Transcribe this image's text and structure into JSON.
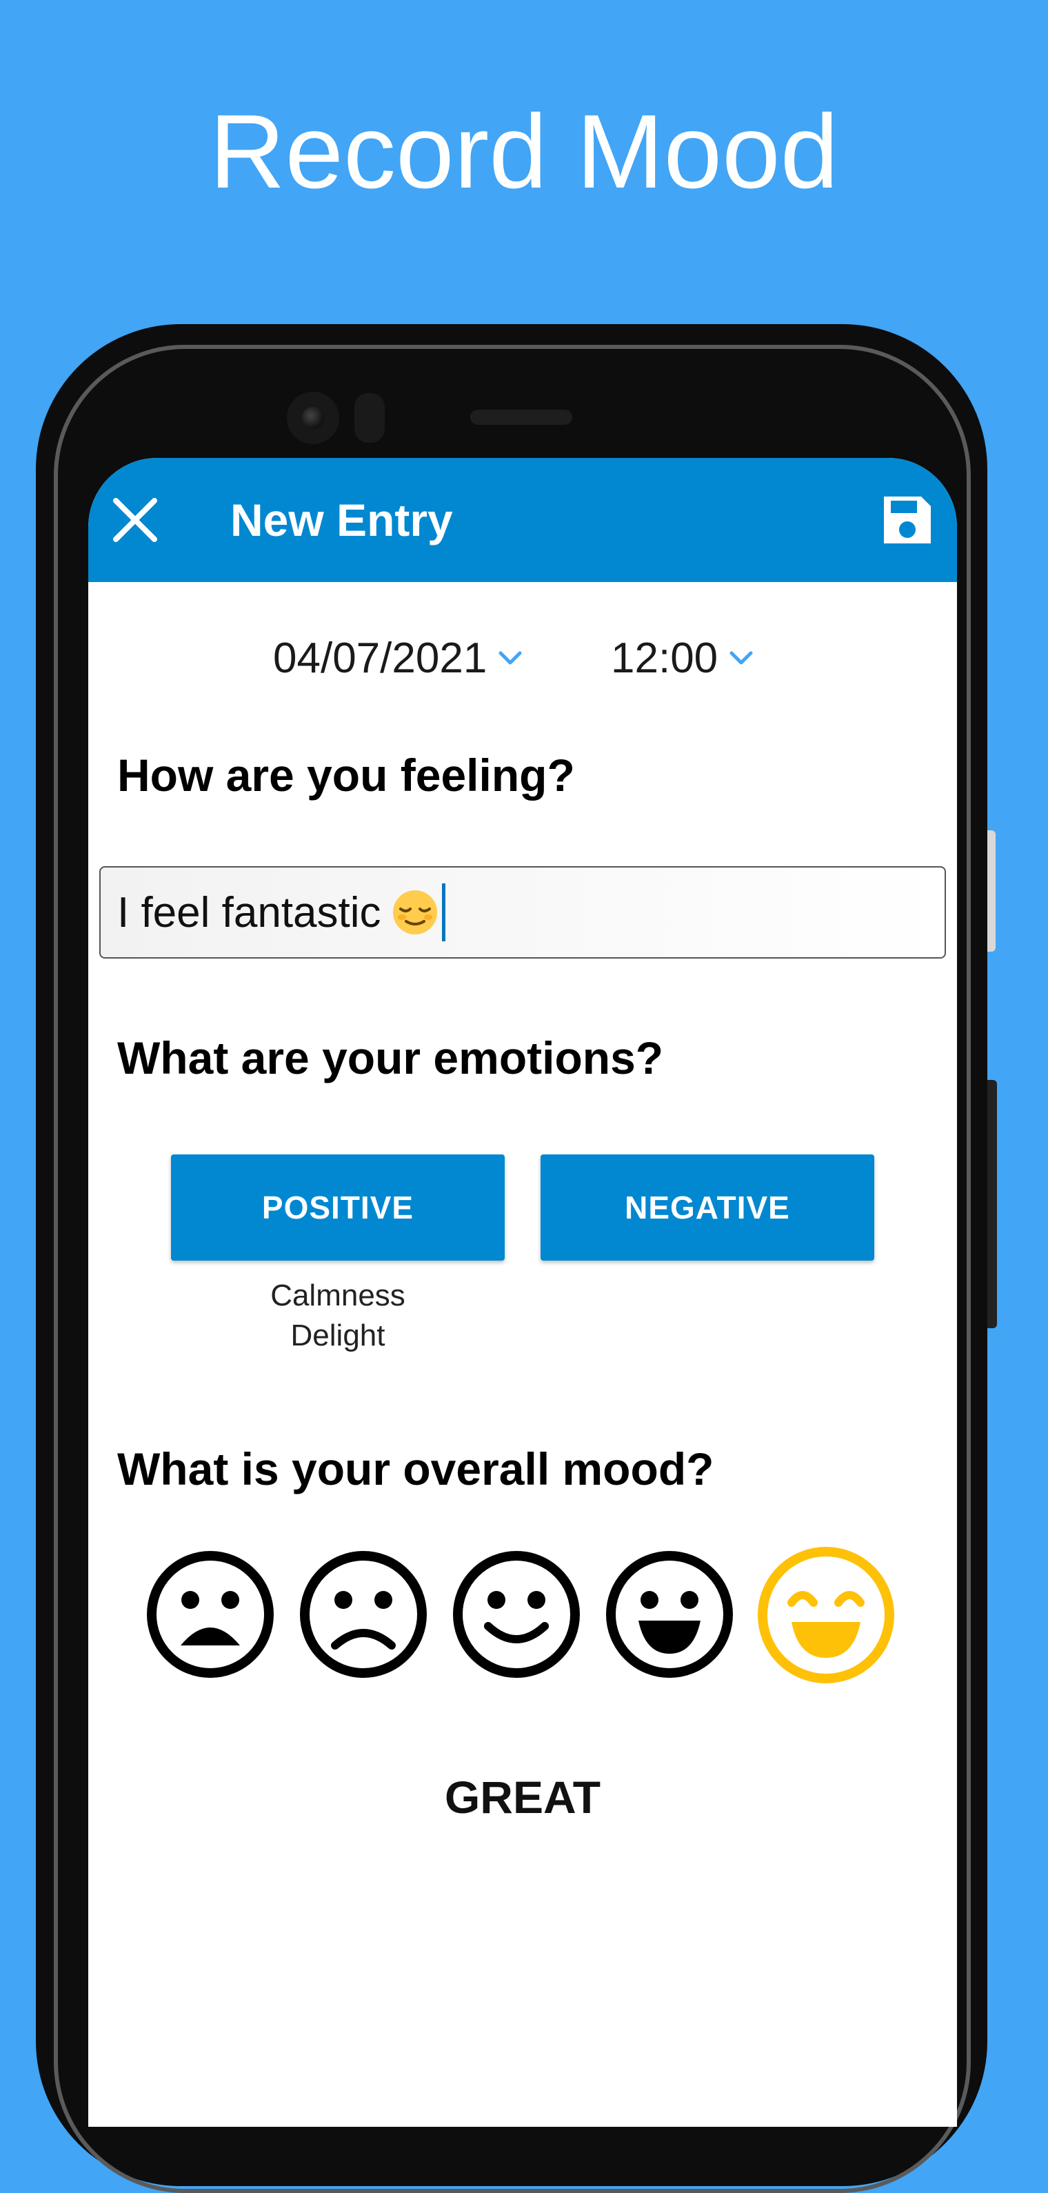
{
  "promo": {
    "title": "Record Mood"
  },
  "appbar": {
    "title": "New Entry",
    "close_icon": "close-icon",
    "save_icon": "floppy-disk-icon",
    "background_color": "#0288d1"
  },
  "datetime": {
    "date": "04/07/2021",
    "time": "12:00"
  },
  "feeling": {
    "question": "How are you feeling?",
    "input_value": "I feel fantastic",
    "input_emoji": "relieved-face-emoji"
  },
  "emotions": {
    "question": "What are your emotions?",
    "positive_label": "POSITIVE",
    "negative_label": "NEGATIVE",
    "selected_positive": [
      "Calmness",
      "Delight"
    ]
  },
  "mood": {
    "question": "What is your overall mood?",
    "options": [
      "very-sad-face-icon",
      "sad-face-icon",
      "smile-face-icon",
      "happy-face-icon",
      "great-face-icon"
    ],
    "selected_label": "GREAT",
    "selected_color": "#ffc107"
  },
  "colors": {
    "page_background": "#42a5f5",
    "accent": "#0288d1"
  }
}
